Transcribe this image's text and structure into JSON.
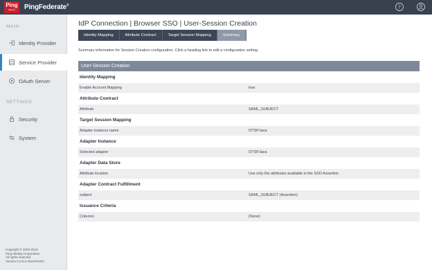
{
  "header": {
    "logo_text": "Ping",
    "logo_subtext": "Identity",
    "product": "PingFederate",
    "product_mark": "®"
  },
  "sidebar": {
    "main_label": "MAIN",
    "main_items": [
      {
        "label": "Identity Provider",
        "icon": "arrow-in-icon"
      },
      {
        "label": "Service Provider",
        "icon": "server-icon",
        "active": true
      },
      {
        "label": "OAuth Server",
        "icon": "oauth-icon"
      }
    ],
    "settings_label": "SETTINGS",
    "settings_items": [
      {
        "label": "Security",
        "icon": "lock-icon"
      },
      {
        "label": "System",
        "icon": "sliders-icon"
      }
    ],
    "copyright": [
      "Copyright © 2003-2019",
      "Ping Identity Corporation",
      "All rights reserved",
      "Version 9.3.0.5-SNAPSHOT"
    ]
  },
  "main": {
    "title": "IdP Connection | Browser SSO | User-Session Creation",
    "tabs": [
      "Identity Mapping",
      "Attribute Contract",
      "Target Session Mapping",
      "Summary"
    ],
    "active_tab": 3,
    "summary_note": "Summary information for Session Creation configuration. Click a heading link to edit a configuration setting.",
    "panel_title": "User-Session Creation",
    "groups": [
      {
        "title": "Identity Mapping",
        "rows": [
          {
            "label": "Enable Account Mapping",
            "value": "true"
          }
        ]
      },
      {
        "title": "Attribute Contract",
        "rows": [
          {
            "label": "Attribute",
            "value": "SAML_SUBJECT"
          }
        ]
      },
      {
        "title": "Target Session Mapping",
        "rows": [
          {
            "label": "Adapter instance name",
            "value": "OTSPJava"
          }
        ]
      },
      {
        "title": "Adapter Instance",
        "rows": [
          {
            "label": "Selected adapter",
            "value": "OTSPJava"
          }
        ]
      },
      {
        "title": "Adapter Data Store",
        "rows": [
          {
            "label": "Attribute location",
            "value": "Use only the attributes available in the SSO Assertion"
          }
        ]
      },
      {
        "title": "Adapter Contract Fulfillment",
        "rows": [
          {
            "label": "subject",
            "value": "SAML_SUBJECT (Assertion)"
          }
        ]
      },
      {
        "title": "Issuance Criteria",
        "rows": [
          {
            "label": "Criterion",
            "value": "(None)"
          }
        ]
      }
    ]
  },
  "colors": {
    "topbar": "#394150",
    "brand_red": "#c8202f",
    "tab_dark": "#3d4656",
    "tab_active": "#8e98a8",
    "panel_header": "#7e8898",
    "active_accent": "#2e86c1"
  }
}
